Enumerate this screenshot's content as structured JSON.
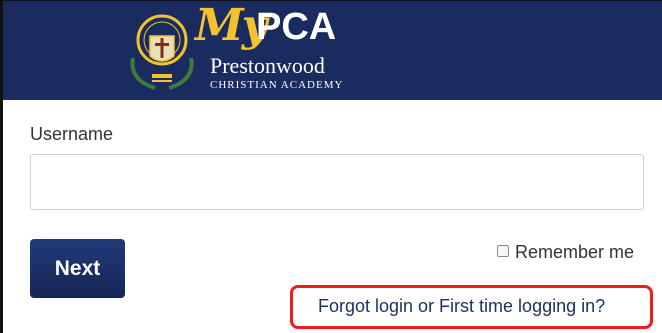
{
  "header": {
    "brand_my": "My",
    "brand_pca": "PCA",
    "school_name": "Prestonwood",
    "school_subtitle": "CHRISTIAN ACADEMY",
    "crest_icon": "school-crest-icon",
    "header_color": "#1a2b5f",
    "accent_color": "#f2c231"
  },
  "login": {
    "username_label": "Username",
    "username_value": "",
    "next_label": "Next",
    "remember_label": "Remember me",
    "remember_checked": false,
    "forgot_label": "Forgot login or First time logging in?",
    "button_color": "#1a2b5f",
    "highlight_color": "#ee1c1c"
  }
}
